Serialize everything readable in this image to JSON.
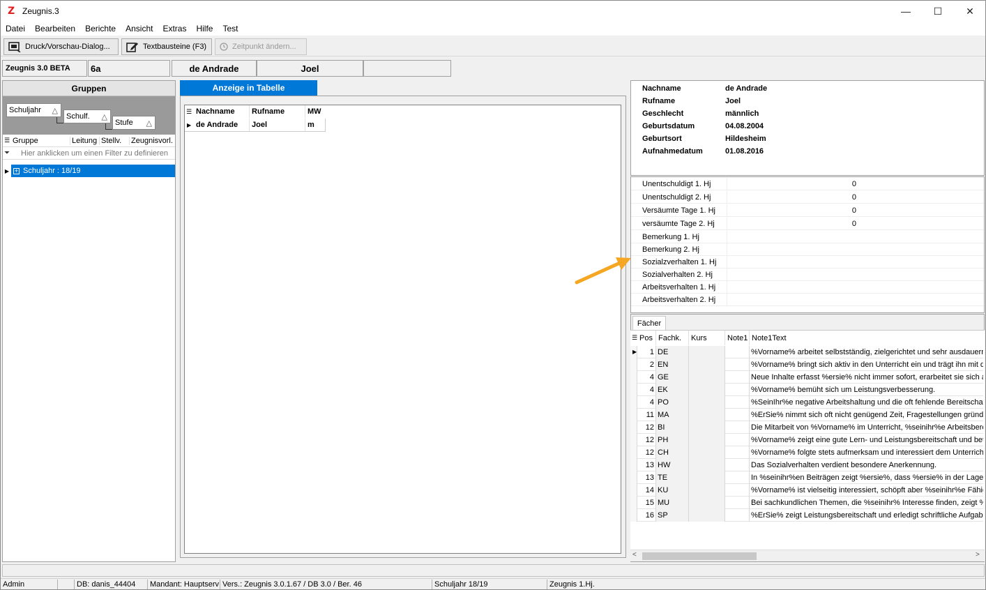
{
  "window": {
    "title": "Zeugnis.3",
    "logo_letter": "Z",
    "minimize": "—",
    "maximize": "☐",
    "close": "✕"
  },
  "menu": [
    "Datei",
    "Bearbeiten",
    "Berichte",
    "Ansicht",
    "Extras",
    "Hilfe",
    "Test"
  ],
  "toolbar": {
    "print_label": "Druck/Vorschau-Dialog...",
    "textbausteine_label": "Textbausteine (F3)",
    "zeitpunkt_label": "Zeitpunkt ändern..."
  },
  "info": {
    "app_version": "Zeugnis 3.0 BETA",
    "klasse": "6a",
    "nachname": "de Andrade",
    "vorname": "Joel"
  },
  "left": {
    "header": "Gruppen",
    "group_boxes": [
      "Schuljahr",
      "Schulf.",
      "Stufe"
    ],
    "sort_glyph": "△",
    "columns": [
      "Gruppe",
      "Leitung",
      "Stellv.",
      "Zeugnisvorl."
    ],
    "filter_hint": "Hier anklicken um einen Filter zu definieren",
    "tree_row": "Schuljahr : 18/19"
  },
  "center": {
    "tab_label": "Anzeige in Tabelle",
    "columns": [
      "Nachname",
      "Rufname",
      "MW"
    ],
    "row": [
      "de Andrade",
      "Joel",
      "m"
    ]
  },
  "student": [
    {
      "label": "Nachname",
      "value": "de Andrade"
    },
    {
      "label": "Rufname",
      "value": "Joel"
    },
    {
      "label": "Geschlecht",
      "value": "männlich"
    },
    {
      "label": "Geburtsdatum",
      "value": "04.08.2004"
    },
    {
      "label": "Geburtsort",
      "value": "Hildesheim"
    },
    {
      "label": "Aufnahmedatum",
      "value": "01.08.2016"
    }
  ],
  "attendance": [
    {
      "label": "Unentschuldigt 1. Hj",
      "value": "0"
    },
    {
      "label": "Unentschuldigt 2. Hj",
      "value": "0"
    },
    {
      "label": "Versäumte Tage 1. Hj",
      "value": "0"
    },
    {
      "label": "versäumte Tage 2. Hj",
      "value": "0"
    },
    {
      "label": "Bemerkung 1. Hj",
      "value": ""
    },
    {
      "label": "Bemerkung 2. Hj",
      "value": ""
    },
    {
      "label": "Sozialzverhalten 1. Hj",
      "value": ""
    },
    {
      "label": "Sozialverhalten 2. Hj",
      "value": ""
    },
    {
      "label": "Arbeitsverhalten 1. Hj",
      "value": ""
    },
    {
      "label": "Arbeitsverhalten 2. Hj",
      "value": ""
    }
  ],
  "faecher": {
    "tab_label": "Fächer",
    "columns": [
      "Pos",
      "Fachk.",
      "Kurs",
      "Note1",
      "Note1Text"
    ],
    "rows": [
      {
        "pos": "1",
        "fach": "DE",
        "text": "%Vorname% arbeitet selbstständig, zielgerichtet und sehr ausdauernd"
      },
      {
        "pos": "2",
        "fach": "EN",
        "text": "%Vorname% bringt sich aktiv in den Unterricht ein und trägt ihn mit de"
      },
      {
        "pos": "4",
        "fach": "GE",
        "text": "Neue Inhalte erfasst %ersie% nicht immer sofort, erarbeitet sie sich a"
      },
      {
        "pos": "4",
        "fach": "EK",
        "text": "%Vorname% bemüht sich um Leistungsverbesserung."
      },
      {
        "pos": "4",
        "fach": "PO",
        "text": "%SeinIhr%e negative Arbeitshaltung und die oft fehlende Bereitschaft"
      },
      {
        "pos": "11",
        "fach": "MA",
        "text": "%ErSie% nimmt sich oft nicht genügend Zeit, Fragestellungen gründlic"
      },
      {
        "pos": "12",
        "fach": "BI",
        "text": "Die Mitarbeit von %Vorname% im Unterricht, %seinihr%e Arbeitsbereit"
      },
      {
        "pos": "12",
        "fach": "PH",
        "text": "%Vorname% zeigt eine gute Lern- und Leistungsbereitschaft und betei"
      },
      {
        "pos": "12",
        "fach": "CH",
        "text": "%Vorname% folgte stets aufmerksam und interessiert dem Unterricht"
      },
      {
        "pos": "13",
        "fach": "HW",
        "text": "Das Sozialverhalten verdient besondere Anerkennung."
      },
      {
        "pos": "13",
        "fach": "TE",
        "text": "In %seinihr%en Beiträgen zeigt %ersie%, dass %ersie% in der Lage"
      },
      {
        "pos": "14",
        "fach": "KU",
        "text": "%Vorname% ist vielseitig interessiert, schöpft aber %seinihr%e Fähigk"
      },
      {
        "pos": "15",
        "fach": "MU",
        "text": "Bei sachkundlichen Themen, die %seinihr% Interesse finden, zeigt %e"
      },
      {
        "pos": "16",
        "fach": "SP",
        "text": "%ErSie% zeigt Leistungsbereitschaft und erledigt schriftliche Aufgaben"
      }
    ]
  },
  "status": {
    "user": "Admin",
    "db": "DB: danis_44404",
    "mandant": "Mandant: Hauptserv",
    "version": "Vers.: Zeugnis 3.0.1.67 / DB 3.0 / Ber. 46",
    "schuljahr": "Schuljahr 18/19",
    "zeugnis": "Zeugnis 1.Hj."
  },
  "colors": {
    "accent": "#0078d7",
    "arrow": "#f5a623",
    "logo": "#e02020"
  }
}
